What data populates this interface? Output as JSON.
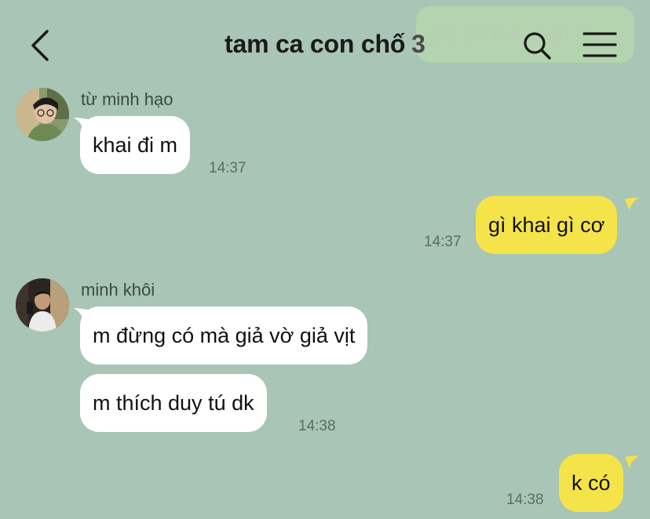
{
  "header": {
    "title": "tam ca con chố",
    "member_count": "3",
    "ghost_banner_text": "đệ sẽ làm thật tốt"
  },
  "messages": [
    {
      "sender": "từ minh hạo",
      "text": "khai đi m",
      "time": "14:37",
      "direction": "in"
    },
    {
      "text": "gì khai gì cơ",
      "time": "14:37",
      "direction": "out"
    },
    {
      "sender": "minh khôi",
      "text": "m đừng có mà giả vờ giả vịt",
      "direction": "in"
    },
    {
      "text": "m thích duy tú dk",
      "time": "14:38",
      "direction": "in"
    },
    {
      "text": "k có",
      "time": "14:38",
      "direction": "out"
    }
  ],
  "colors": {
    "background": "#a8c5b5",
    "incoming_bubble": "#ffffff",
    "outgoing_bubble": "#f5e34a"
  },
  "icons": [
    "back-arrow-icon",
    "search-icon",
    "menu-icon"
  ]
}
